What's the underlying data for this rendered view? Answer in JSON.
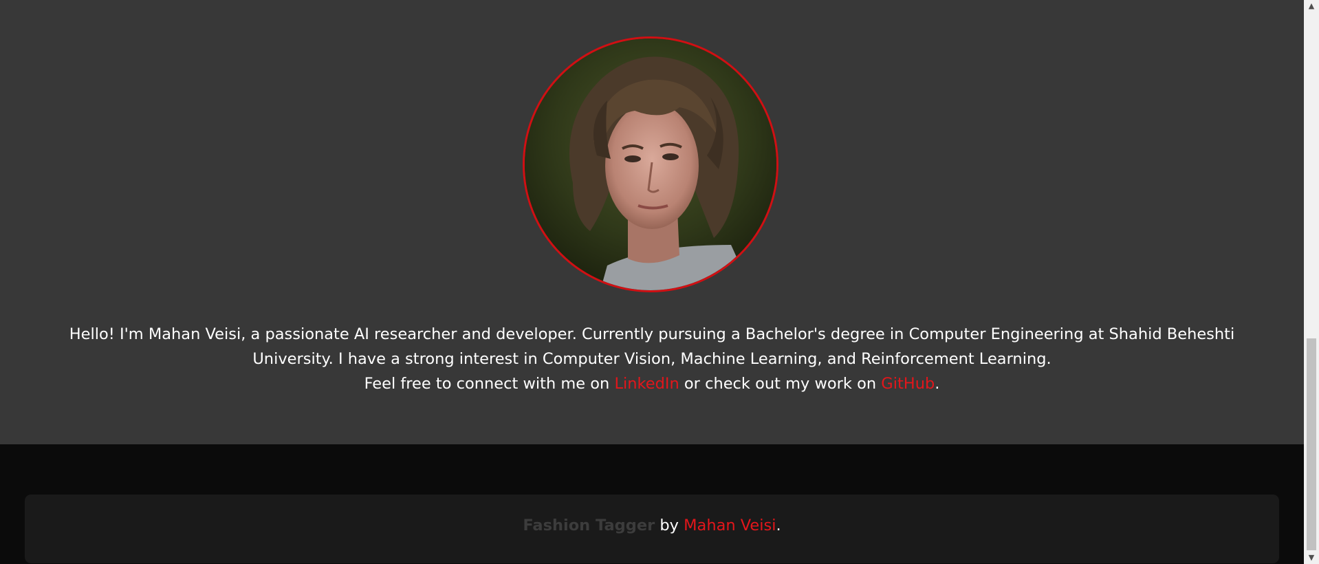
{
  "about": {
    "avatar_alt": "Mahan Veisi",
    "bio_line1": "Hello! I'm Mahan Veisi, a passionate AI researcher and developer. Currently pursuing a Bachelor's degree in Computer Engineering at Shahid Beheshti University. I have a strong interest in Computer Vision, Machine Learning, and Reinforcement Learning.",
    "bio_line2_prefix": "Feel free to connect with me on ",
    "linkedin_label": "LinkedIn",
    "bio_line2_middle": " or check out my work on ",
    "github_label": "GitHub",
    "bio_line2_suffix": "."
  },
  "footer": {
    "brand": "Fashion Tagger",
    "by": " by ",
    "author": "Mahan Veisi",
    "suffix": "."
  },
  "scrollbar": {
    "up_icon": "▲",
    "down_icon": "▼"
  },
  "colors": {
    "accent": "#e3161b",
    "section_bg": "#383838",
    "footer_bg": "#0b0b0b",
    "card_bg": "#1a1a1a"
  }
}
